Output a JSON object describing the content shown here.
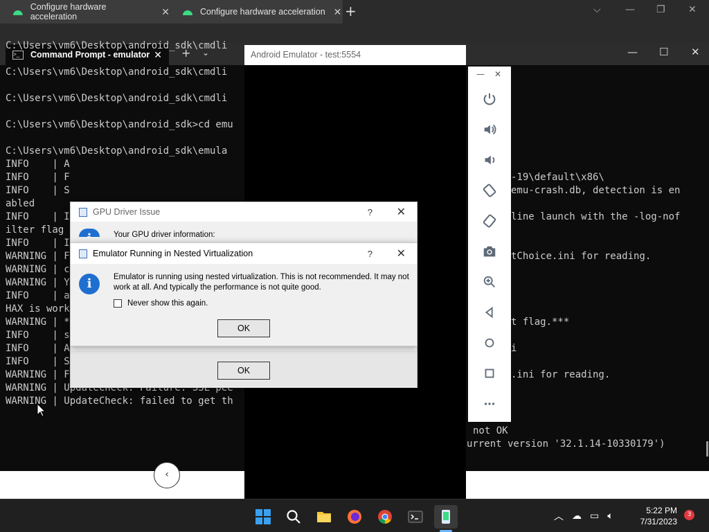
{
  "browser": {
    "tabs": [
      {
        "label": "Configure hardware acceleration"
      },
      {
        "label": "Configure hardware acceleration"
      }
    ],
    "new_tab": "+"
  },
  "terminal": {
    "tab_title": "Command Prompt - emulator",
    "lines": [
      "C:\\Users\\vm6\\Desktop\\android_sdk\\cmdli",
      "",
      "C:\\Users\\vm6\\Desktop\\android_sdk\\cmdli",
      "",
      "C:\\Users\\vm6\\Desktop\\android_sdk\\cmdli",
      "",
      "C:\\Users\\vm6\\Desktop\\android_sdk>cd emu",
      "",
      "C:\\Users\\vm6\\Desktop\\android_sdk\\emula",
      "INFO    | A",
      "INFO    | F",
      "INFO    | S",
      "abled",
      "INFO    | I",
      "ilter flag",
      "INFO    | I",
      "WARNING | F",
      "WARNING | c",
      "WARNING | Y",
      "INFO    | a",
      "HAX is work",
      "WARNING | *",
      "INFO    | s",
      "INFO    | Advertising in: C:\\Users\\vm6\\",
      "INFO    | Setting display: 0 configurat",
      "WARNING | Failed to process .ini file C",
      "WARNING | UpdateCheck: Failure: SSL pee",
      "WARNING | UpdateCheck: failed to get th"
    ],
    "right_lines": [
      "-19\\default\\x86\\",
      "emu-crash.db, detection is en",
      "",
      "line launch with the -log-nof",
      "",
      "",
      "tChoice.ini for reading.",
      "",
      "",
      "",
      "",
      "t flag.***",
      "",
      "i",
      "",
      ".ini for reading."
    ],
    "bottom_right_1": "not OK",
    "bottom_right_2": "urrent version '32.1.14-10330179')"
  },
  "emulator": {
    "title": "Android Emulator - test:5554",
    "tools": [
      "power-icon",
      "volume-up-icon",
      "volume-down-icon",
      "rotate-left-icon",
      "rotate-right-icon",
      "camera-icon",
      "zoom-icon",
      "back-icon",
      "home-icon",
      "overview-icon",
      "more-icon"
    ]
  },
  "gpu_dialog": {
    "title": "GPU Driver Issue",
    "help": "?",
    "text": "Your GPU driver information:",
    "ok": "OK"
  },
  "nested_dialog": {
    "title": "Emulator Running in Nested Virtualization",
    "help": "?",
    "message": "Emulator is running using nested virtualization. This is not recommended. It may not work at all. And typically the performance is not quite good.",
    "checkbox_label": "Never show this again.",
    "ok": "OK"
  },
  "taskbar": {
    "time": "5:22 PM",
    "date": "7/31/2023",
    "badge": "3"
  }
}
